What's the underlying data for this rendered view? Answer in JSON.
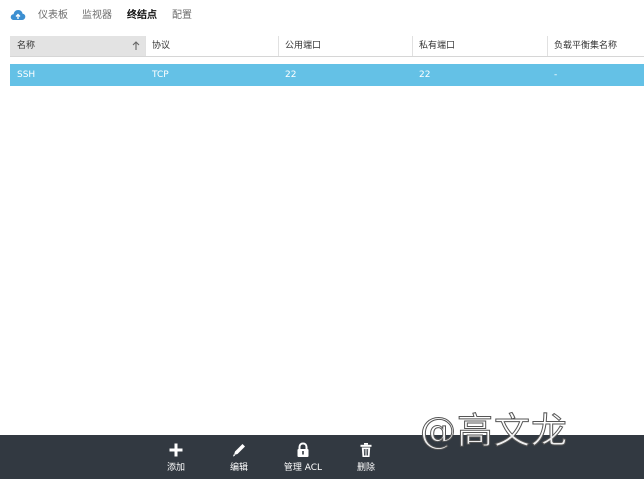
{
  "nav": {
    "logo_icon": "cloud-icon",
    "tabs": [
      {
        "label": "仪表板",
        "active": false
      },
      {
        "label": "监视器",
        "active": false
      },
      {
        "label": "终结点",
        "active": true
      },
      {
        "label": "配置",
        "active": false
      }
    ]
  },
  "table": {
    "columns": [
      "名称",
      "协议",
      "公用端口",
      "私有端口",
      "负载平衡集名称"
    ],
    "sorted_column": "名称",
    "sort_icon": "arrow-up-icon",
    "rows": [
      {
        "name": "SSH",
        "protocol": "TCP",
        "public_port": "22",
        "private_port": "22",
        "load_balanced_set": "-",
        "selected": true
      }
    ]
  },
  "commands": [
    {
      "label": "添加",
      "icon": "plus-icon"
    },
    {
      "label": "编辑",
      "icon": "pencil-icon"
    },
    {
      "label": "管理 ACL",
      "icon": "lock-icon"
    },
    {
      "label": "删除",
      "icon": "trash-icon"
    }
  ],
  "colors": {
    "accent": "#64c1e6",
    "command_bar": "#323941",
    "logo": "#3c8fd1"
  },
  "watermark": "@高文龙"
}
